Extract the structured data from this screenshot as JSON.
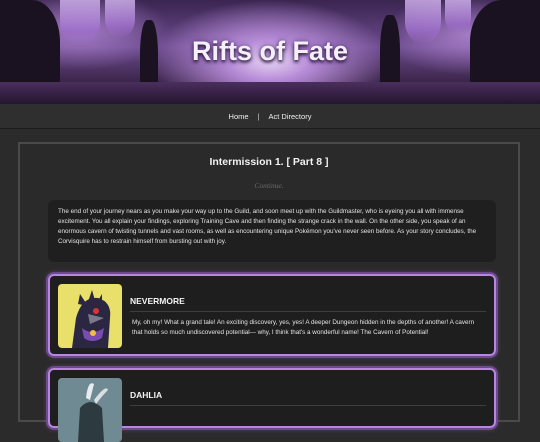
{
  "banner": {
    "title": "Rifts of Fate"
  },
  "nav": {
    "items": [
      "Home",
      "Act Directory"
    ],
    "separator": "|"
  },
  "chapter": {
    "title": "Intermission 1. [ Part 8 ]",
    "continue_label": "Continue.",
    "narration": "The end of your journey nears as you make your way up to the Guild, and soon meet up with the Guildmaster, who is eyeing you all with immense excitement. You all explain your findings, exploring Training Cave and then finding the strange crack in the wall. On the other side, you speak of an enormous cavern of twisting tunnels and vast rooms, as well as encountering unique Pokémon you've never seen before. As your story concludes, the Corvisquire has to restrain himself from bursting out with joy."
  },
  "dialogs": [
    {
      "speaker": "NEVERMORE",
      "text": "My, oh my! What a grand tale! An exciting discovery, yes, yes! A deeper Dungeon hidden in the depths of another! A cavern that holds so much undiscovered potential— why, I think that's a wonderful name! The Cavern of Potential!",
      "avatar_icon": "corvisquire-portrait"
    },
    {
      "speaker": "DAHLIA",
      "text": "",
      "avatar_icon": "dahlia-portrait"
    }
  ],
  "colors": {
    "accent": "#b786e0",
    "panel": "#2a2a2a",
    "box": "#1f1f1f"
  }
}
